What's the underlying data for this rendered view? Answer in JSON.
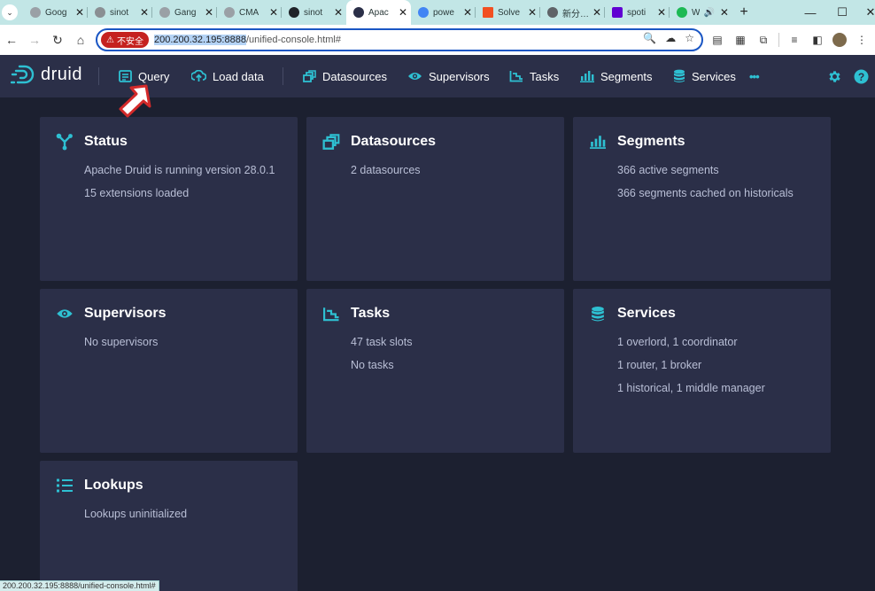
{
  "browser": {
    "tabs": [
      {
        "title": "Goog",
        "favicon_color": "#9aa0a6"
      },
      {
        "title": "sinot",
        "favicon_color": "#8a8f93"
      },
      {
        "title": "Gang",
        "favicon_color": "#9aa0a6"
      },
      {
        "title": "CMA",
        "favicon_color": "#9aa0a6"
      },
      {
        "title": "sinot",
        "favicon_color": "#1f2328"
      },
      {
        "title": "Apac",
        "favicon_color": "#2b2f48",
        "active": true
      },
      {
        "title": "powe",
        "favicon_color": "#4285f4"
      },
      {
        "title": "Solve",
        "favicon_color": "#f25022"
      },
      {
        "title": "新分…",
        "favicon_color": "#5f6368"
      },
      {
        "title": "spoti",
        "favicon_color": "#6001d2"
      },
      {
        "title": "W",
        "favicon_color": "#1db954"
      }
    ],
    "new_tab_glyph": "+",
    "address": {
      "security_label": "不安全",
      "host": "200.200.32.195:8888",
      "path": "/unified-console.html#"
    },
    "status_url": "200.200.32.195:8888/unified-console.html#"
  },
  "druid": {
    "logo_text": "druid",
    "nav": [
      {
        "label": "Query",
        "icon": "query-icon"
      },
      {
        "label": "Load data",
        "icon": "upload-icon"
      },
      {
        "label": "Datasources",
        "icon": "datasources-icon"
      },
      {
        "label": "Supervisors",
        "icon": "eye-icon"
      },
      {
        "label": "Tasks",
        "icon": "tasks-icon"
      },
      {
        "label": "Segments",
        "icon": "segments-icon"
      },
      {
        "label": "Services",
        "icon": "database-icon"
      }
    ],
    "more_glyph": "•••"
  },
  "cards": [
    {
      "title": "Status",
      "icon": "status-icon",
      "lines": [
        "Apache Druid is running version 28.0.1",
        "15 extensions loaded"
      ]
    },
    {
      "title": "Datasources",
      "icon": "datasources-icon",
      "lines": [
        "2 datasources"
      ]
    },
    {
      "title": "Segments",
      "icon": "segments-icon",
      "lines": [
        "366 active segments",
        "366 segments cached on historicals"
      ]
    },
    {
      "title": "Supervisors",
      "icon": "eye-icon",
      "lines": [
        "No supervisors"
      ]
    },
    {
      "title": "Tasks",
      "icon": "tasks-icon",
      "lines": [
        "47 task slots",
        "No tasks"
      ]
    },
    {
      "title": "Services",
      "icon": "database-icon",
      "lines": [
        "1 overlord, 1 coordinator",
        "1 router, 1 broker",
        "1 historical, 1 middle manager"
      ]
    },
    {
      "title": "Lookups",
      "icon": "list-icon",
      "lines": [
        "Lookups uninitialized"
      ]
    }
  ],
  "colors": {
    "accent": "#2ec0d2",
    "header_bg": "#2b2f48",
    "page_bg": "#1c2030",
    "card_bg": "#2b2f48",
    "tabstrip_bg": "#c2e6e6",
    "insecure_red": "#c5221f"
  }
}
